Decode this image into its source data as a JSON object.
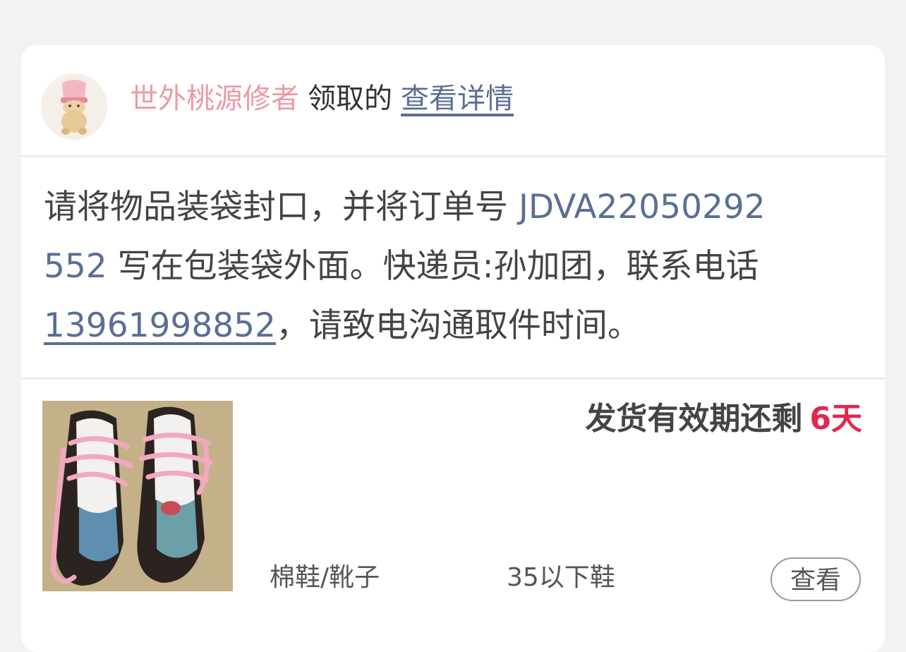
{
  "header": {
    "username": "世外桃源修者",
    "action_text": "领取的",
    "detail_link": "查看详情"
  },
  "message": {
    "line1_prefix": "请将物品装袋封口，并将订单号 ",
    "order_number_part1": "JDVA22050292",
    "order_number_part2": "552",
    "line2_suffix": " 写在包装袋外面。快递员:孙加团，联系电话",
    "phone": "13961998852",
    "line3_suffix": "，请致电沟通取件时间。"
  },
  "item": {
    "deadline_label": "发货有效期还剩",
    "deadline_days": "6天",
    "category": "棉鞋/靴子",
    "size": "35以下鞋",
    "view_button": "查看",
    "thumbnail_icon": "sneakers-photo"
  },
  "colors": {
    "username": "#ee9aa4",
    "link": "#5a6f94",
    "highlight_days": "#e0284e",
    "background": "#f2f2f2"
  }
}
